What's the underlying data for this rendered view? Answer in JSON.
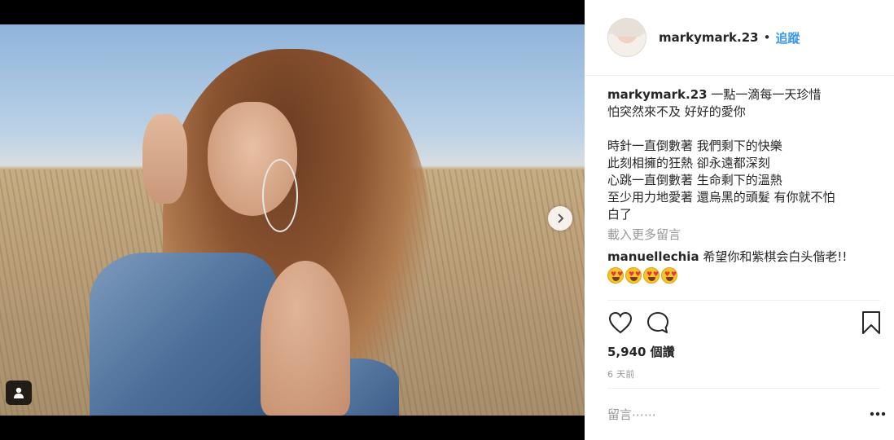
{
  "post": {
    "username": "markymark.23",
    "separator": "•",
    "follow_label": "追蹤",
    "caption_lines": [
      "一點一滴每一天珍惜",
      "怕突然來不及 好好的愛你",
      "",
      "時針一直倒數著 我們剩下的快樂",
      "此刻相擁的狂熱 卻永遠都深刻",
      "心跳一直倒數著 生命剩下的溫熱",
      "至少用力地愛著 還烏黑的頭髮 有你就不怕",
      "白了"
    ],
    "load_more_label": "載入更多留言",
    "comments": [
      {
        "username": "manuellechia",
        "text": "希望你和紫棋会白头偕老!!",
        "emojis": [
          "heart-eyes",
          "heart-eyes",
          "heart-eyes",
          "heart-eyes"
        ]
      }
    ],
    "likes_label": "5,940 個讚",
    "time_label": "6 天前",
    "add_comment_placeholder": "留言⋯⋯"
  },
  "icons": {
    "next": "chevron-right-icon",
    "tag": "user-tag-icon",
    "like": "heart-icon",
    "comment": "comment-bubble-icon",
    "save": "bookmark-icon",
    "more": "more-dots-icon"
  },
  "colors": {
    "link_blue": "#3897f0",
    "muted_gray": "#999999",
    "text": "#262626"
  }
}
